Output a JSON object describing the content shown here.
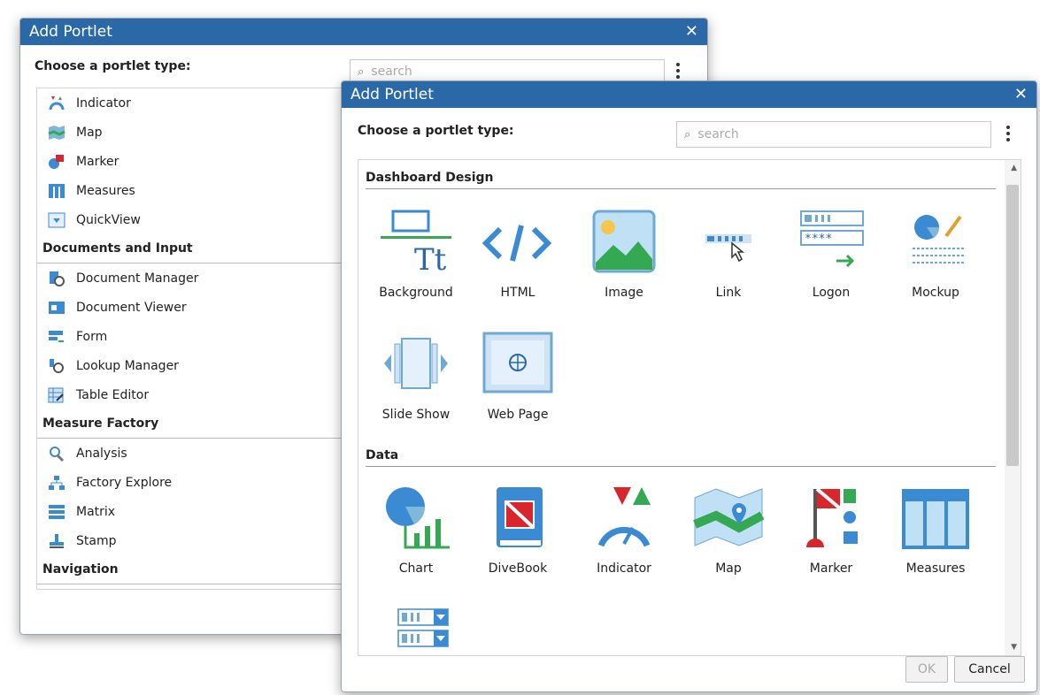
{
  "back_dialog": {
    "title": "Add Portlet",
    "choose_label": "Choose a portlet type:",
    "search_placeholder": "search",
    "items": [
      {
        "label": "Indicator"
      },
      {
        "label": "Map"
      },
      {
        "label": "Marker"
      },
      {
        "label": "Measures"
      },
      {
        "label": "QuickView"
      },
      {
        "header": "Documents and Input"
      },
      {
        "label": "Document Manager"
      },
      {
        "label": "Document Viewer"
      },
      {
        "label": "Form"
      },
      {
        "label": "Lookup Manager"
      },
      {
        "label": "Table Editor"
      },
      {
        "header": "Measure Factory"
      },
      {
        "label": "Analysis"
      },
      {
        "label": "Factory Explore"
      },
      {
        "label": "Matrix"
      },
      {
        "label": "Stamp"
      },
      {
        "header": "Navigation"
      }
    ]
  },
  "front_dialog": {
    "title": "Add Portlet",
    "choose_label": "Choose a portlet type:",
    "search_placeholder": "search",
    "sections": [
      {
        "name": "Dashboard Design",
        "tiles": [
          "Background",
          "HTML",
          "Image",
          "Link",
          "Logon",
          "Mockup",
          "Slide Show",
          "Web Page"
        ]
      },
      {
        "name": "Data",
        "tiles": [
          "Chart",
          "DiveBook",
          "Indicator",
          "Map",
          "Marker",
          "Measures"
        ]
      }
    ],
    "ok_label": "OK",
    "cancel_label": "Cancel"
  },
  "colors": {
    "title_bar": "#2a68a8",
    "accent_blue": "#3a8ad4",
    "red": "#d9262c",
    "green": "#34a853"
  }
}
